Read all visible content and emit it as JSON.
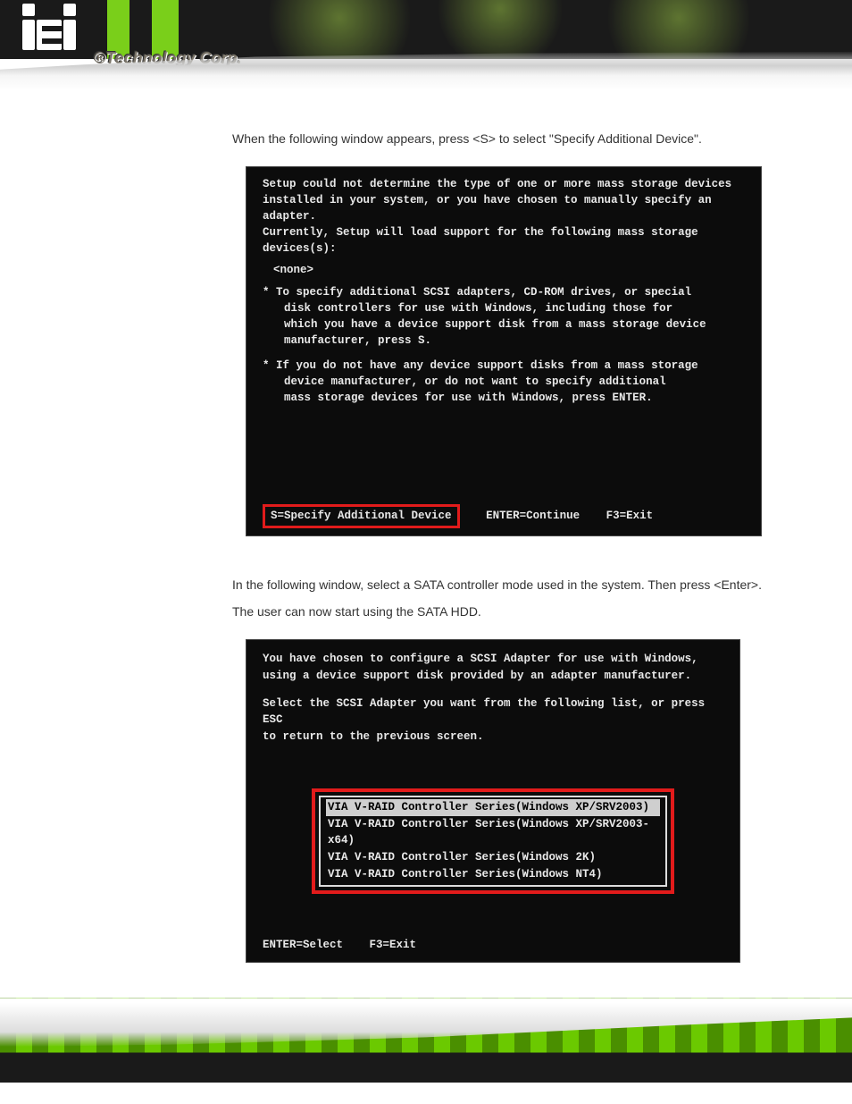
{
  "brand": {
    "tagline": "®Technology Corp."
  },
  "step7": {
    "intro_a": "When the following window appears, press <",
    "intro_key": "S",
    "intro_b": "> to select \"Specify Additional Device\"."
  },
  "screen1": {
    "line1": "Setup could not determine the type of one or more mass storage devices",
    "line2": "installed in your system, or you have chosen to manually specify an adapter.",
    "line3": "Currently, Setup will load support for the following mass storage devices(s):",
    "none": "<none>",
    "b1l1": "To specify additional SCSI adapters, CD-ROM drives, or special",
    "b1l2": "disk controllers for use with Windows, including those for",
    "b1l3": "which you have a device support disk from a mass storage device",
    "b1l4": "manufacturer, press S.",
    "b2l1": "If you do not have any device support disks from a mass storage",
    "b2l2": "device manufacturer, or do not want to specify additional",
    "b2l3": "mass storage devices for use with Windows, press ENTER.",
    "footer_s": "S=Specify Additional Device",
    "footer_enter": "ENTER=Continue",
    "footer_f3": "F3=Exit"
  },
  "step8": {
    "intro_a": "In the following window, select a SATA controller mode used in the system. Then press <",
    "intro_key": "Enter",
    "intro_b": ">. The user can now start using the SATA HDD."
  },
  "screen2": {
    "line1": "You have chosen to configure a SCSI Adapter for use with Windows,",
    "line2": "using a device support disk provided by an adapter manufacturer.",
    "line3": "Select the SCSI Adapter you want from the following list, or press ESC",
    "line4": "to return to the previous screen.",
    "options": [
      "VIA V-RAID Controller Series(Windows XP/SRV2003)",
      "VIA V-RAID Controller Series(Windows XP/SRV2003-x64)",
      "VIA V-RAID Controller Series(Windows 2K)",
      "VIA V-RAID Controller Series(Windows NT4)"
    ],
    "footer_enter": "ENTER=Select",
    "footer_f3": "F3=Exit"
  }
}
